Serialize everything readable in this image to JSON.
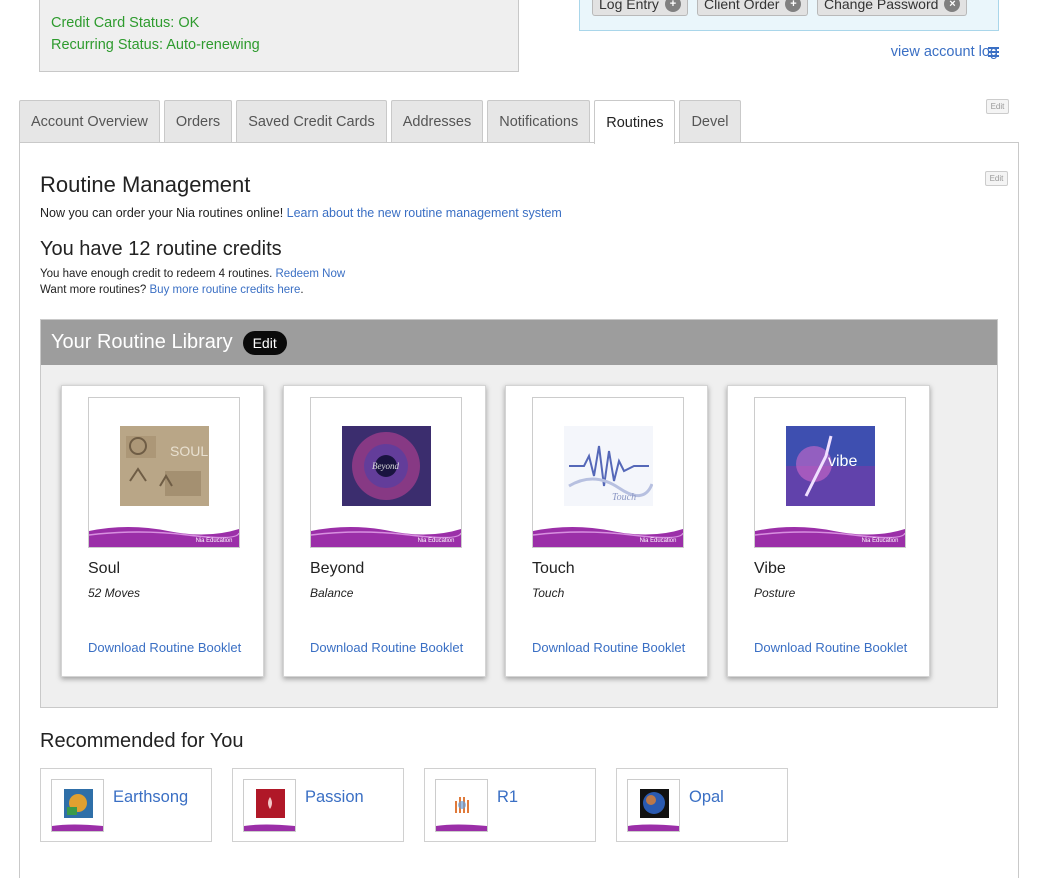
{
  "status": {
    "credit_card": "Credit Card Status: OK",
    "recurring": "Recurring Status: Auto-renewing"
  },
  "actions": {
    "log_entry": "Log Entry",
    "client_order": "Client Order",
    "change_password": "Change Password",
    "view_account_log": "view account log"
  },
  "edit_small": "Edit",
  "tabs": [
    {
      "label": "Account Overview"
    },
    {
      "label": "Orders"
    },
    {
      "label": "Saved Credit Cards"
    },
    {
      "label": "Addresses"
    },
    {
      "label": "Notifications"
    },
    {
      "label": "Routines",
      "active": true
    },
    {
      "label": "Devel"
    }
  ],
  "routines": {
    "title": "Routine Management",
    "intro_text": "Now you can order your Nia routines online! ",
    "intro_link": "Learn about the new routine management system",
    "credits_heading": "You have 12 routine credits",
    "redeem_text": "You have enough credit to redeem 4 routines. ",
    "redeem_link": "Redeem Now",
    "more_text": "Want more routines? ",
    "more_link": "Buy more routine credits here",
    "more_suffix": "."
  },
  "library": {
    "title": "Your Routine Library",
    "edit_label": "Edit",
    "download_label": "Download Routine Booklet",
    "brand_text": "Nia Education",
    "items": [
      {
        "name": "Soul",
        "subtitle": "52 Moves",
        "art_text": "SOUL"
      },
      {
        "name": "Beyond",
        "subtitle": "Balance",
        "art_text": "Beyond"
      },
      {
        "name": "Touch",
        "subtitle": "Touch",
        "art_text": "Touch"
      },
      {
        "name": "Vibe",
        "subtitle": "Posture",
        "art_text": "vibe"
      }
    ]
  },
  "recommended": {
    "title": "Recommended for You",
    "items": [
      {
        "name": "Earthsong"
      },
      {
        "name": "Passion"
      },
      {
        "name": "R1"
      },
      {
        "name": "Opal"
      }
    ]
  },
  "colors": {
    "status_green": "#2e9b2e",
    "link_blue": "#3a6fc4",
    "library_header": "#9d9d9d",
    "nia_purple": "#9b2fa8"
  }
}
